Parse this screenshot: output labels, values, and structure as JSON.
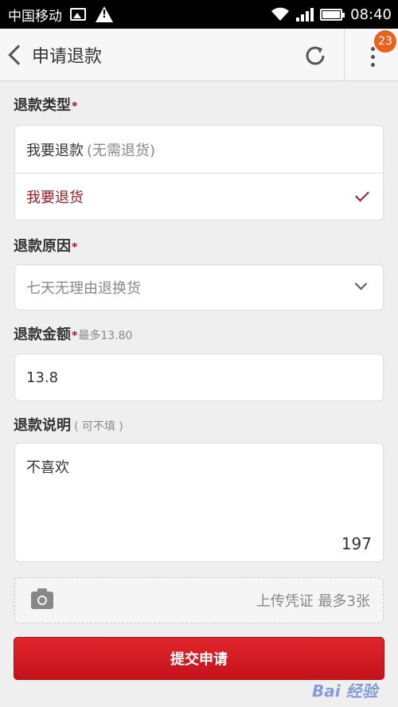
{
  "status_bar": {
    "carrier": "中国移动",
    "time": "08:40"
  },
  "header": {
    "title": "申请退款",
    "badge_count": "23"
  },
  "refund_type": {
    "label": "退款类型",
    "required_mark": "*",
    "options": [
      {
        "label": "我要退款",
        "sub": "(无需退货)",
        "selected": false
      },
      {
        "label": "我要退货",
        "sub": "",
        "selected": true
      }
    ]
  },
  "refund_reason": {
    "label": "退款原因",
    "required_mark": "*",
    "placeholder": "七天无理由退换货"
  },
  "refund_amount": {
    "label": "退款金额",
    "required_mark": "*",
    "hint": "最多13.80",
    "value": "13.8"
  },
  "refund_note": {
    "label": "退款说明",
    "hint": "( 可不填 )",
    "value": "不喜欢",
    "remaining": "197"
  },
  "upload": {
    "label": "上传凭证 最多3张"
  },
  "submit_label": "提交申请",
  "watermark": "Bai 经验",
  "colors": {
    "accent": "#9a1c24",
    "button": "#d31c23",
    "badge": "#e8611e"
  }
}
